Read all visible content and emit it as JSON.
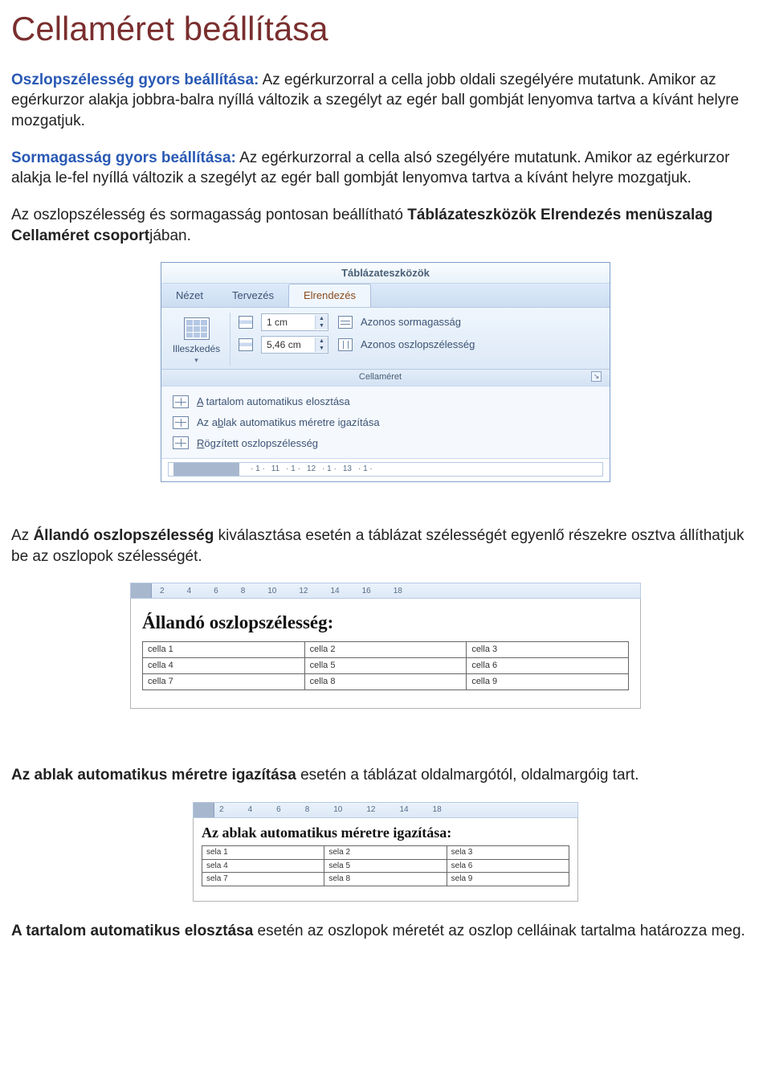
{
  "title": "Cellaméret beállítása",
  "p1_lead": "Oszlopszélesség gyors beállítása:",
  "p1_rest": " Az egérkurzorral a cella jobb oldali szegélyére mutatunk. Amikor az egérkurzor alakja jobbra-balra nyíllá változik a szegélyt az egér ball gombját lenyomva tartva a kívánt helyre mozgatjuk.",
  "p2_lead": "Sormagasság gyors beállítása:",
  "p2_rest": " Az egérkurzorral a cella alsó szegélyére mutatunk. Amikor az egérkurzor alakja le-fel nyíllá változik a szegélyt az egér ball gombját lenyomva tartva a kívánt helyre mozgatjuk.",
  "p3_a": "Az oszlopszélesség és sormagasság pontosan beállítható ",
  "p3_b": "Táblázateszközök Elrendezés menüszalag Cellaméret csoport",
  "p3_c": "jában.",
  "p4_a": "Az ",
  "p4_b": "Állandó oszlopszélesség",
  "p4_c": " kiválasztása esetén a táblázat szélességét egyenlő részekre osztva állíthatjuk be az oszlopok szélességét.",
  "p5_a": "Az ablak automatikus méretre igazítása",
  "p5_b": " esetén a táblázat oldalmargótól, oldalmargóig tart.",
  "p6_a": "A tartalom automatikus elosztása",
  "p6_b": " esetén az oszlopok méretét az oszlop celláinak tartalma határozza meg.",
  "ribbon": {
    "context_title": "Táblázateszközök",
    "tabs": {
      "nezet": "Nézet",
      "tervezes": "Tervezés",
      "elrendezes": "Elrendezés"
    },
    "illeszkedes": "Illeszkedés",
    "height_val": "1 cm",
    "width_val": "5,46 cm",
    "equal_rows": "Azonos sormagasság",
    "equal_cols": "Azonos oszlopszélesség",
    "group_name": "Cellaméret",
    "menu": {
      "auto_content_u": "A",
      "auto_content": " tartalom automatikus elosztása",
      "auto_window": "Az a",
      "auto_window_u": "b",
      "auto_window2": "lak automatikus méretre igazítása",
      "fixed_u": "R",
      "fixed": "ögzített oszlopszélesség"
    },
    "ruler_ticks": [
      "· 1 ·",
      "11",
      "· 1 ·",
      "12",
      "· 1 ·",
      "13",
      "· 1 ·"
    ]
  },
  "shot1": {
    "ticks": [
      "2",
      "4",
      "6",
      "8",
      "10",
      "12",
      "14",
      "16",
      "18"
    ],
    "heading": "Állandó oszlopszélesség:",
    "cells": [
      "cella 1",
      "cella 2",
      "cella 3",
      "cella 4",
      "cella 5",
      "cella 6",
      "cella 7",
      "cella 8",
      "cella 9"
    ]
  },
  "shot2": {
    "ticks": [
      "2",
      "4",
      "6",
      "8",
      "10",
      "12",
      "14",
      "18"
    ],
    "heading": "Az ablak automatikus méretre igazítása:",
    "cells": [
      "sela 1",
      "sela 2",
      "sela 3",
      "sela 4",
      "sela 5",
      "sela 6",
      "sela 7",
      "sela 8",
      "sela 9"
    ]
  }
}
